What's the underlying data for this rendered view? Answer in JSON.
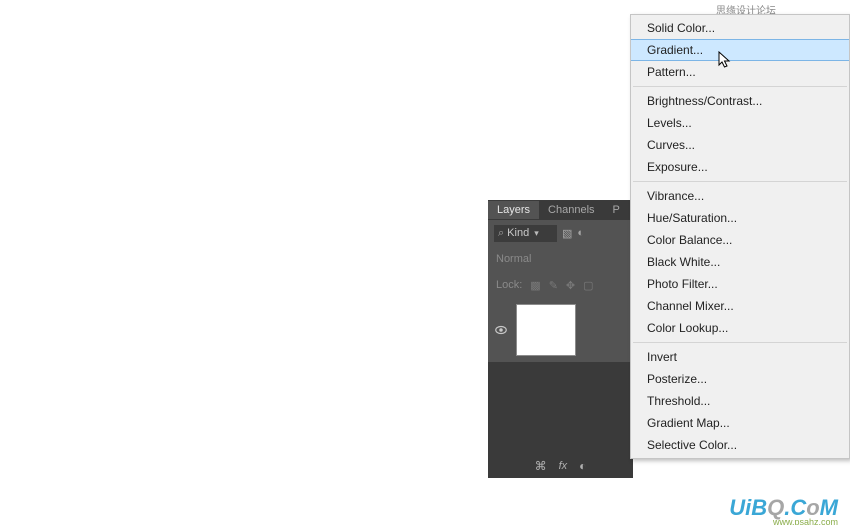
{
  "watermarks": {
    "top": "思缘设计论坛 WWW.MISSYUAN.COM",
    "bottom_main_1": "UiB",
    "bottom_main_2": "Q",
    "bottom_main_3": ".C",
    "bottom_main_4": "o",
    "bottom_main_5": "M",
    "bottom_sub": "www.psahz.com"
  },
  "layers_panel": {
    "tabs": {
      "layers": "Layers",
      "channels": "Channels",
      "paths_initial": "P"
    },
    "filter": {
      "kind": "Kind"
    },
    "mode": "Normal",
    "lock_label": "Lock:"
  },
  "menu": {
    "items": [
      {
        "label": "Solid Color...",
        "hover": false
      },
      {
        "label": "Gradient...",
        "hover": true
      },
      {
        "label": "Pattern...",
        "hover": false
      },
      {
        "sep": true
      },
      {
        "label": "Brightness/Contrast...",
        "hover": false
      },
      {
        "label": "Levels...",
        "hover": false
      },
      {
        "label": "Curves...",
        "hover": false
      },
      {
        "label": "Exposure...",
        "hover": false
      },
      {
        "sep": true
      },
      {
        "label": "Vibrance...",
        "hover": false
      },
      {
        "label": "Hue/Saturation...",
        "hover": false
      },
      {
        "label": "Color Balance...",
        "hover": false
      },
      {
        "label": "Black  White...",
        "hover": false
      },
      {
        "label": "Photo Filter...",
        "hover": false
      },
      {
        "label": "Channel Mixer...",
        "hover": false
      },
      {
        "label": "Color Lookup...",
        "hover": false
      },
      {
        "sep": true
      },
      {
        "label": "Invert",
        "hover": false
      },
      {
        "label": "Posterize...",
        "hover": false
      },
      {
        "label": "Threshold...",
        "hover": false
      },
      {
        "label": "Gradient Map...",
        "hover": false
      },
      {
        "label": "Selective Color...",
        "hover": false
      }
    ]
  }
}
